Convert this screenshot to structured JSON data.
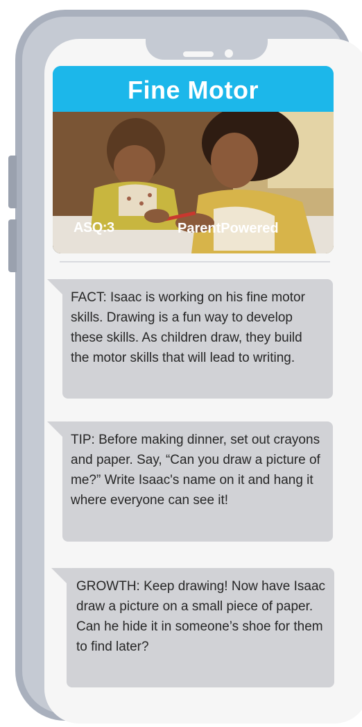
{
  "header": {
    "title": "Fine Motor",
    "logos": {
      "asq": "ASQ:3",
      "parent_powered": "ParentPowered"
    }
  },
  "messages": [
    {
      "id": "fact",
      "text": "FACT: Isaac is working on his fine motor skills. Drawing is a fun way to develop these skills. As children draw, they build the motor skills that will lead to writing."
    },
    {
      "id": "tip",
      "text": "TIP: Before making dinner, set out crayons and paper. Say, “Can you draw a picture of me?” Write Isaac's name on it and hang it where everyone can see it!"
    },
    {
      "id": "growth",
      "text": "GROWTH: Keep drawing! Now have Isaac draw a picture on a small piece of paper. Can he hide it in someone’s shoe for them to find later?"
    }
  ],
  "colors": {
    "header_blue": "#1cb7ea",
    "bubble_gray": "#d1d2d6",
    "phone_frame": "#a9b0bd"
  }
}
